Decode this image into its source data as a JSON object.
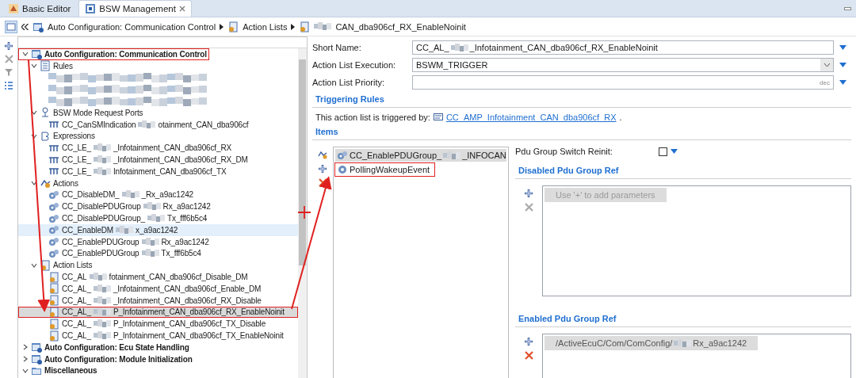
{
  "tabs": [
    {
      "label": "Basic Editor",
      "kind": "editor",
      "selected": false,
      "closable": false
    },
    {
      "label": "BSW Management",
      "kind": "bsw",
      "selected": true,
      "closable": true
    }
  ],
  "breadcrumb": [
    {
      "kind": "config",
      "parts": [
        {
          "kind": "text",
          "text": "Auto Configuration: Communication Control"
        }
      ]
    },
    {
      "kind": "action_list",
      "parts": [
        {
          "kind": "text",
          "text": "Action Lists"
        }
      ]
    },
    {
      "kind": "action_list",
      "parts": [
        {
          "kind": "blur"
        },
        {
          "kind": "text",
          "text": "CAN_dba906cf_RX_EnableNoinit"
        }
      ]
    }
  ],
  "tree": [
    {
      "kind": "config",
      "parts": [
        {
          "kind": "text",
          "text": "Auto Configuration: Communication Control"
        }
      ],
      "expanded": true,
      "selected": false,
      "hovered": false,
      "boxed": true,
      "children": [
        {
          "kind": "rules",
          "parts": [
            {
              "kind": "text",
              "text": "Rules"
            }
          ],
          "expanded": true,
          "selected": false,
          "hovered": false,
          "boxed": false,
          "children": [
            {
              "kind": "redacted",
              "parts": [
                {
                  "kind": "blur"
                }
              ],
              "selected": false,
              "hovered": false,
              "boxed": false
            },
            {
              "kind": "redacted",
              "parts": [
                {
                  "kind": "blur"
                }
              ],
              "selected": false,
              "hovered": false,
              "boxed": false
            },
            {
              "kind": "redacted",
              "parts": [
                {
                  "kind": "blur"
                }
              ],
              "selected": false,
              "hovered": false,
              "boxed": false
            }
          ]
        },
        {
          "kind": "ports",
          "parts": [
            {
              "kind": "text",
              "text": "BSW Mode Request Ports"
            }
          ],
          "expanded": true,
          "selected": false,
          "hovered": false,
          "boxed": false,
          "children": [
            {
              "kind": "port",
              "parts": [
                {
                  "kind": "text",
                  "text": "CC_CanSMIndication"
                },
                {
                  "kind": "blur"
                },
                {
                  "kind": "text",
                  "text": "otainment_CAN_dba906cf"
                }
              ],
              "selected": false,
              "hovered": false,
              "boxed": false
            }
          ]
        },
        {
          "kind": "expressions",
          "parts": [
            {
              "kind": "text",
              "text": "Expressions"
            }
          ],
          "expanded": true,
          "selected": false,
          "hovered": false,
          "boxed": false,
          "children": [
            {
              "kind": "port",
              "parts": [
                {
                  "kind": "text",
                  "text": "CC_LE_"
                },
                {
                  "kind": "blur"
                },
                {
                  "kind": "text",
                  "text": "_Infotainment_CAN_dba906cf_RX"
                }
              ],
              "selected": false,
              "hovered": false,
              "boxed": false
            },
            {
              "kind": "port",
              "parts": [
                {
                  "kind": "text",
                  "text": "CC_LE_"
                },
                {
                  "kind": "blur"
                },
                {
                  "kind": "text",
                  "text": "_Infotainment_CAN_dba906cf_RX_DM"
                }
              ],
              "selected": false,
              "hovered": false,
              "boxed": false
            },
            {
              "kind": "port",
              "parts": [
                {
                  "kind": "text",
                  "text": "CC_LE_"
                },
                {
                  "kind": "blur"
                },
                {
                  "kind": "text",
                  "text": "Infotainment_CAN_dba906cf_TX"
                }
              ],
              "selected": false,
              "hovered": false,
              "boxed": false
            }
          ]
        },
        {
          "kind": "actions",
          "parts": [
            {
              "kind": "text",
              "text": "Actions"
            }
          ],
          "expanded": true,
          "selected": false,
          "hovered": false,
          "boxed": false,
          "children": [
            {
              "kind": "action",
              "parts": [
                {
                  "kind": "text",
                  "text": "CC_DisableDM_"
                },
                {
                  "kind": "blur"
                },
                {
                  "kind": "text",
                  "text": "_Rx_a9ac1242"
                }
              ],
              "selected": false,
              "hovered": false,
              "boxed": false
            },
            {
              "kind": "action",
              "parts": [
                {
                  "kind": "text",
                  "text": "CC_DisablePDUGroup"
                },
                {
                  "kind": "blur"
                },
                {
                  "kind": "text",
                  "text": "Rx_a9ac1242"
                }
              ],
              "selected": false,
              "hovered": false,
              "boxed": false
            },
            {
              "kind": "action",
              "parts": [
                {
                  "kind": "text",
                  "text": "CC_DisablePDUGroup_"
                },
                {
                  "kind": "blur"
                },
                {
                  "kind": "text",
                  "text": "Tx_fff6b5c4"
                }
              ],
              "selected": false,
              "hovered": false,
              "boxed": false
            },
            {
              "kind": "action",
              "parts": [
                {
                  "kind": "text",
                  "text": "CC_EnableDM"
                },
                {
                  "kind": "blur"
                },
                {
                  "kind": "text",
                  "text": "x_a9ac1242"
                }
              ],
              "selected": false,
              "hovered": true,
              "boxed": false
            },
            {
              "kind": "action",
              "parts": [
                {
                  "kind": "text",
                  "text": "CC_EnablePDUGroup"
                },
                {
                  "kind": "blur"
                },
                {
                  "kind": "text",
                  "text": "Rx_a9ac1242"
                }
              ],
              "selected": false,
              "hovered": false,
              "boxed": false
            },
            {
              "kind": "action",
              "parts": [
                {
                  "kind": "text",
                  "text": "CC_EnablePDUGroup"
                },
                {
                  "kind": "blur"
                },
                {
                  "kind": "text",
                  "text": "Tx_fff6b5c4"
                }
              ],
              "selected": false,
              "hovered": false,
              "boxed": false
            }
          ]
        },
        {
          "kind": "action_lists",
          "parts": [
            {
              "kind": "text",
              "text": "Action Lists"
            }
          ],
          "expanded": true,
          "selected": false,
          "hovered": false,
          "boxed": false,
          "children": [
            {
              "kind": "action_list",
              "parts": [
                {
                  "kind": "text",
                  "text": "CC_AL"
                },
                {
                  "kind": "blur"
                },
                {
                  "kind": "text",
                  "text": "fotainment_CAN_dba906cf_Disable_DM"
                }
              ],
              "selected": false,
              "hovered": false,
              "boxed": false
            },
            {
              "kind": "action_list",
              "parts": [
                {
                  "kind": "text",
                  "text": "CC_AL_"
                },
                {
                  "kind": "blur"
                },
                {
                  "kind": "text",
                  "text": "_Infotainment_CAN_dba906cf_Enable_DM"
                }
              ],
              "selected": false,
              "hovered": false,
              "boxed": false
            },
            {
              "kind": "action_list",
              "parts": [
                {
                  "kind": "text",
                  "text": "CC_AL_"
                },
                {
                  "kind": "blur"
                },
                {
                  "kind": "text",
                  "text": "_Infotainment_CAN_dba906cf_RX_Disable"
                }
              ],
              "selected": false,
              "hovered": false,
              "boxed": false
            },
            {
              "kind": "action_list",
              "parts": [
                {
                  "kind": "text",
                  "text": "CC_AL_"
                },
                {
                  "kind": "blur"
                },
                {
                  "kind": "text",
                  "text": "P_Infotainment_CAN_dba906cf_RX_EnableNoinit"
                }
              ],
              "selected": true,
              "hovered": false,
              "boxed": true
            },
            {
              "kind": "action_list",
              "parts": [
                {
                  "kind": "text",
                  "text": "CC_AL_"
                },
                {
                  "kind": "blur"
                },
                {
                  "kind": "text",
                  "text": "P_Infotainment_CAN_dba906cf_TX_Disable"
                }
              ],
              "selected": false,
              "hovered": false,
              "boxed": false
            },
            {
              "kind": "action_list",
              "parts": [
                {
                  "kind": "text",
                  "text": "CC_AL_"
                },
                {
                  "kind": "blur"
                },
                {
                  "kind": "text",
                  "text": "P_Infotainment_CAN_dba906cf_TX_EnableNoinit"
                }
              ],
              "selected": false,
              "hovered": false,
              "boxed": false
            }
          ]
        }
      ]
    },
    {
      "kind": "config",
      "parts": [
        {
          "kind": "text",
          "text": "Auto Configuration: Ecu State Handling"
        }
      ],
      "expanded": false,
      "selected": false,
      "hovered": false,
      "boxed": false
    },
    {
      "kind": "config",
      "parts": [
        {
          "kind": "text",
          "text": "Auto Configuration: Module Initialization"
        }
      ],
      "expanded": false,
      "selected": false,
      "hovered": false,
      "boxed": false
    },
    {
      "kind": "folder",
      "parts": [
        {
          "kind": "text",
          "text": "Miscellaneous"
        }
      ],
      "expanded": true,
      "selected": false,
      "hovered": false,
      "boxed": false
    }
  ],
  "form": [
    {
      "label": "Short Name:",
      "kind": "text",
      "parts": [
        {
          "kind": "text",
          "text": "CC_AL_"
        },
        {
          "kind": "blur"
        },
        {
          "kind": "text",
          "text": "_Infotainment_CAN_dba906cf_RX_EnableNoinit"
        }
      ]
    },
    {
      "label": "Action List Execution:",
      "kind": "select",
      "parts": [
        {
          "kind": "text",
          "text": "BSWM_TRIGGER"
        }
      ]
    },
    {
      "label": "Action List Priority:",
      "kind": "number",
      "unit": "dec"
    }
  ],
  "triggering": {
    "heading": "Triggering Rules",
    "text": "This action list is triggered by:",
    "link": "CC_AMP_Infotainment_CAN_dba906cf_RX",
    "tail": "."
  },
  "items": {
    "heading": "Items",
    "list": [
      {
        "kind": "action",
        "parts": [
          {
            "kind": "text",
            "text": "CC_EnablePDUGroup_"
          },
          {
            "kind": "blur"
          },
          {
            "kind": "text",
            "text": "_INFOCAN"
          }
        ],
        "selected": true,
        "boxed": false
      },
      {
        "kind": "event",
        "parts": [
          {
            "kind": "text",
            "text": "PollingWakeupEvent"
          }
        ],
        "selected": false,
        "boxed": true
      }
    ]
  },
  "details": {
    "switch_label": "Pdu Group Switch Reinit:",
    "switch_checked": false,
    "sections": [
      {
        "title": "Disabled Pdu Group Ref",
        "delete_enabled": false,
        "entries": [
          {
            "kind": "hint",
            "parts": [
              {
                "kind": "text",
                "text": "Use '+' to add parameters"
              }
            ]
          }
        ]
      },
      {
        "title": "Enabled Pdu Group Ref",
        "delete_enabled": true,
        "entries": [
          {
            "kind": "ref",
            "parts": [
              {
                "kind": "text",
                "text": "/ActiveEcuC/Com/ComConfig/"
              },
              {
                "kind": "blur"
              },
              {
                "kind": "text",
                "text": "Rx_a9ac1242"
              }
            ]
          }
        ]
      }
    ]
  }
}
